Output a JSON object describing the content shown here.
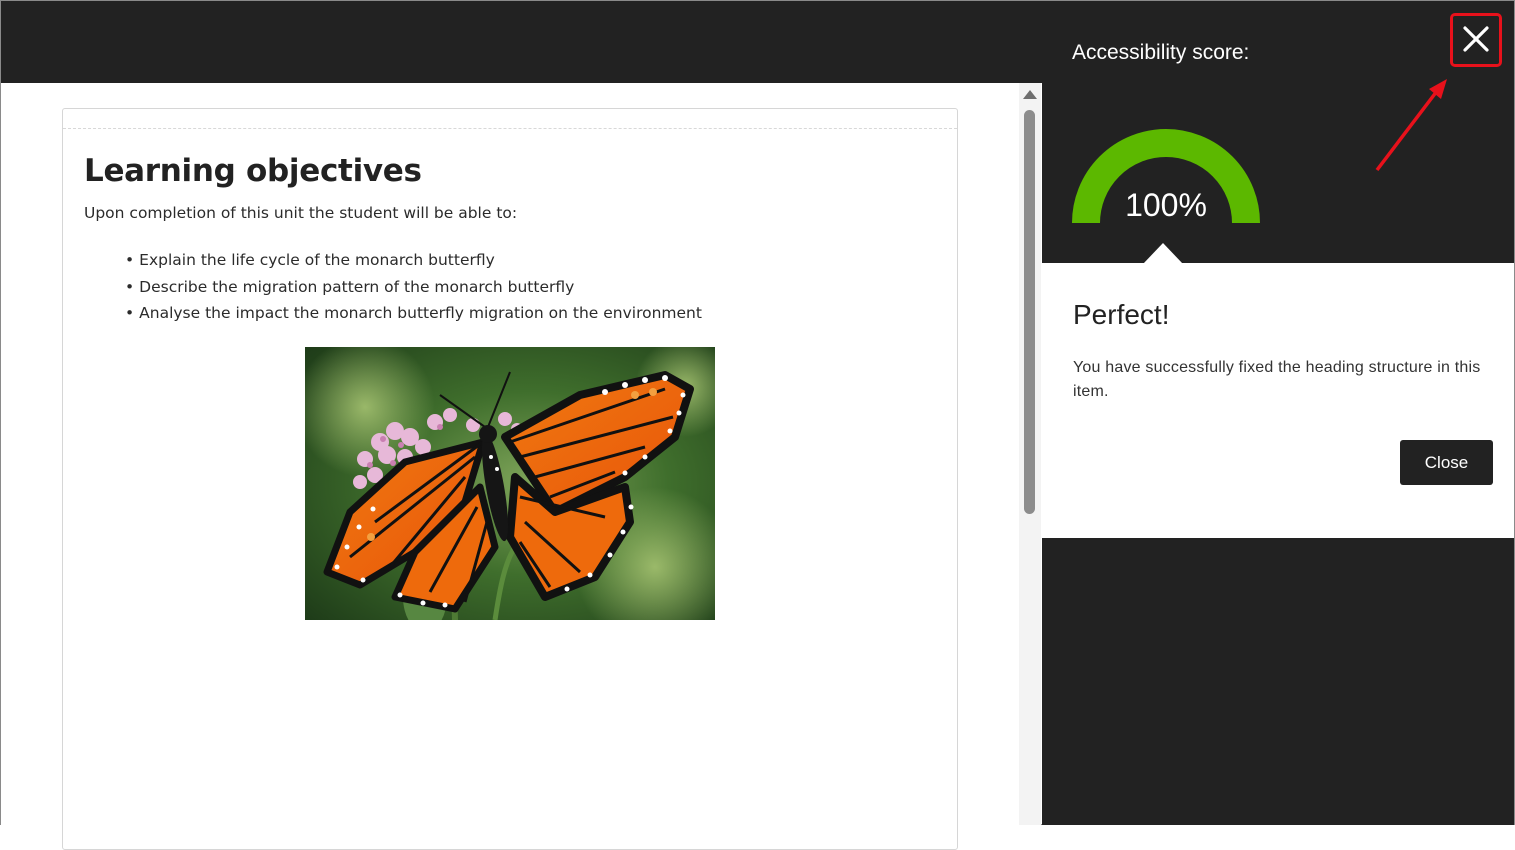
{
  "panel": {
    "title": "Accessibility score:",
    "score": {
      "value": 100,
      "label": "100%",
      "color": "#5cb800"
    },
    "result": {
      "title": "Perfect!",
      "message": "You have successfully fixed the heading structure in this item.",
      "close_label": "Close"
    },
    "close_icon": "close-x-icon",
    "highlight_color": "#e8111b"
  },
  "document": {
    "heading": "Learning objectives",
    "intro": "Upon completion of this unit the student will be able to:",
    "objectives": [
      "Explain the life cycle of the monarch butterfly",
      "Describe the migration pattern of the monarch butterfly",
      "Analyse the impact the monarch butterfly migration on the environment"
    ]
  }
}
